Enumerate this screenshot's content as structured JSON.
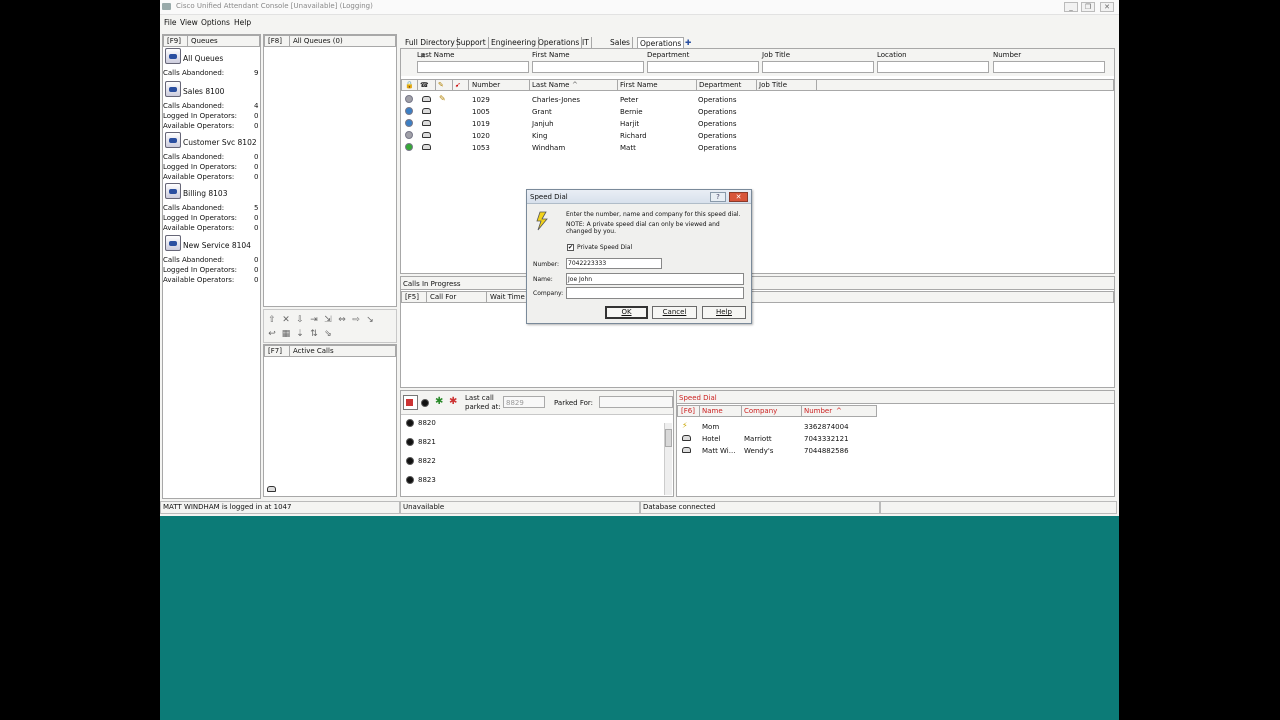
{
  "window": {
    "title": "Cisco Unified Attendant Console [Unavailable] (Logging)",
    "minimize": "_",
    "restore": "❐",
    "close": "✕"
  },
  "menu": [
    "File",
    "View",
    "Options",
    "Help"
  ],
  "queues": {
    "key": "[F9]",
    "label": "Queues",
    "items": [
      {
        "name": "All Queues",
        "stats": [
          {
            "label": "Calls Abandoned:",
            "value": "9"
          }
        ]
      },
      {
        "name": "Sales 8100",
        "stats": [
          {
            "label": "Calls Abandoned:",
            "value": "4"
          },
          {
            "label": "Logged In Operators:",
            "value": "0"
          },
          {
            "label": "Available Operators:",
            "value": "0"
          }
        ]
      },
      {
        "name": "Customer Svc 8102",
        "stats": [
          {
            "label": "Calls Abandoned:",
            "value": "0"
          },
          {
            "label": "Logged In Operators:",
            "value": "0"
          },
          {
            "label": "Available Operators:",
            "value": "0"
          }
        ]
      },
      {
        "name": "Billing 8103",
        "stats": [
          {
            "label": "Calls Abandoned:",
            "value": "5"
          },
          {
            "label": "Logged In Operators:",
            "value": "0"
          },
          {
            "label": "Available Operators:",
            "value": "0"
          }
        ]
      },
      {
        "name": "New Service 8104",
        "stats": [
          {
            "label": "Calls Abandoned:",
            "value": "0"
          },
          {
            "label": "Logged In Operators:",
            "value": "0"
          },
          {
            "label": "Available Operators:",
            "value": "0"
          }
        ]
      }
    ]
  },
  "all_queues": {
    "key": "[F8]",
    "label": "All Queues (0)"
  },
  "active_calls": {
    "key": "[F7]",
    "label": "Active Calls"
  },
  "directory": {
    "tabs": [
      "Full Directory",
      "Support",
      "Engineering",
      "Operations",
      "IT",
      "Sales",
      "Operations"
    ],
    "add_tab": "✚",
    "filters": [
      "Last Name",
      "First Name",
      "Department",
      "Job Title",
      "Location",
      "Number"
    ],
    "columns": [
      "Number",
      "Last Name",
      "First Name",
      "Department",
      "Job Title"
    ],
    "sort_arrow": "^",
    "rows": [
      {
        "status": "grey",
        "number": "1029",
        "last": "Charles-Jones",
        "first": "Peter",
        "dept": "Operations",
        "note": true
      },
      {
        "status": "blue",
        "number": "1005",
        "last": "Grant",
        "first": "Bernie",
        "dept": "Operations",
        "note": false
      },
      {
        "status": "blue",
        "number": "1019",
        "last": "Janjuh",
        "first": "Harjit",
        "dept": "Operations",
        "note": false
      },
      {
        "status": "grey",
        "number": "1020",
        "last": "King",
        "first": "Richard",
        "dept": "Operations",
        "note": false
      },
      {
        "status": "green",
        "number": "1053",
        "last": "Windham",
        "first": "Matt",
        "dept": "Operations",
        "note": false
      }
    ]
  },
  "calls_in_progress": {
    "label": "Calls In Progress",
    "key": "[F5]",
    "columns": [
      "Call For",
      "Wait Time"
    ]
  },
  "park": {
    "last_call_label": "Last call parked at:",
    "last_call_value": "8829",
    "parked_for_label": "Parked For:",
    "slots": [
      "8820",
      "8821",
      "8822",
      "8823"
    ]
  },
  "speed_dial_panel": {
    "title": "Speed Dial",
    "key": "[F6]",
    "columns": [
      "Name",
      "Company",
      "Number"
    ],
    "rows": [
      {
        "name": "Mom",
        "company": "",
        "number": "3362874004"
      },
      {
        "name": "Hotel",
        "company": "Marriott",
        "number": "7043332121"
      },
      {
        "name": "Matt Wi...",
        "company": "Wendy's",
        "number": "7044882586"
      }
    ]
  },
  "status_bar": {
    "user": "MATT WINDHAM is logged in at 1047",
    "state": "Unavailable",
    "db": "Database connected"
  },
  "dialog": {
    "title": "Speed Dial",
    "help_glyph": "?",
    "close_glyph": "✕",
    "instruction": "Enter the number, name and company for this speed dial.",
    "note": "NOTE: A private speed dial can only be viewed and changed by you.",
    "private_label": "Private Speed Dial",
    "private_checked": "✔",
    "number_label": "Number:",
    "number_value": "7042223333",
    "name_label": "Name:",
    "name_value": "Joe John",
    "company_label": "Company:",
    "company_value": "",
    "ok": "OK",
    "cancel": "Cancel",
    "help": "Help"
  }
}
